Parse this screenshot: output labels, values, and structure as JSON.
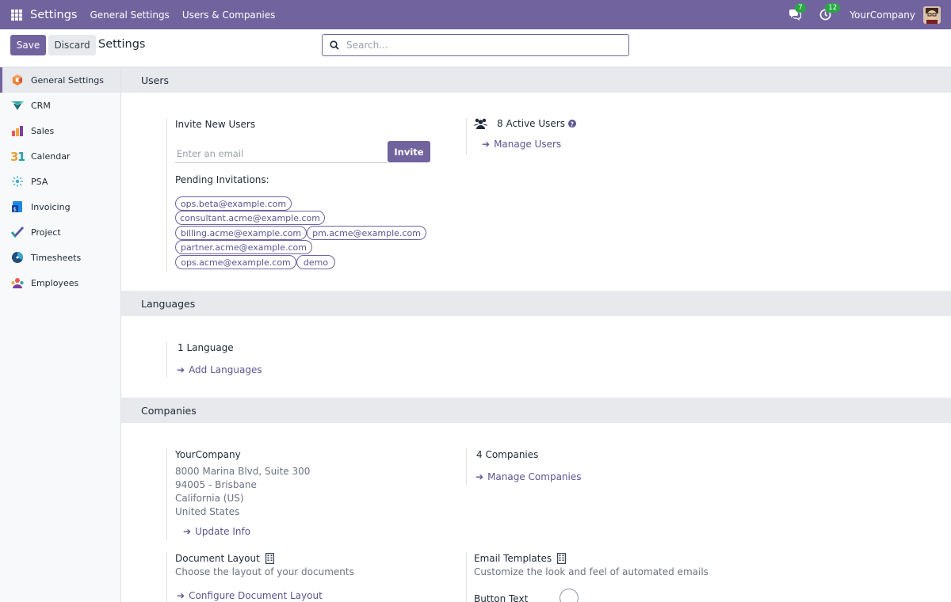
{
  "navbar": {
    "app_title": "Settings",
    "menu": [
      "General Settings",
      "Users & Companies"
    ],
    "messages_count": "7",
    "activities_count": "12",
    "company": "YourCompany"
  },
  "control": {
    "save_label": "Save",
    "discard_label": "Discard",
    "title": "Settings",
    "search_placeholder": "Search..."
  },
  "sidebar": {
    "items": [
      {
        "label": "General Settings",
        "icon": "settings-icon"
      },
      {
        "label": "CRM",
        "icon": "crm-icon"
      },
      {
        "label": "Sales",
        "icon": "sales-icon"
      },
      {
        "label": "Calendar",
        "icon": "calendar-icon"
      },
      {
        "label": "PSA",
        "icon": "psa-icon"
      },
      {
        "label": "Invoicing",
        "icon": "invoicing-icon"
      },
      {
        "label": "Project",
        "icon": "project-icon"
      },
      {
        "label": "Timesheets",
        "icon": "timesheets-icon"
      },
      {
        "label": "Employees",
        "icon": "employees-icon"
      }
    ]
  },
  "users": {
    "section_title": "Users",
    "invite_label": "Invite New Users",
    "email_placeholder": "Enter an email",
    "invite_button": "Invite",
    "pending_label": "Pending Invitations:",
    "pending": [
      "ops.beta@example.com",
      "consultant.acme@example.com",
      "billing.acme@example.com",
      "pm.acme@example.com",
      "partner.acme@example.com",
      "ops.acme@example.com",
      "demo"
    ],
    "active_users": "8 Active Users",
    "manage_users": "Manage Users"
  },
  "languages": {
    "section_title": "Languages",
    "count": "1 Language",
    "add_link": "Add Languages"
  },
  "companies": {
    "section_title": "Companies",
    "company_name": "YourCompany",
    "address": [
      "8000 Marina Blvd, Suite 300",
      "94005 - Brisbane",
      "California (US)",
      "United States"
    ],
    "update_info": "Update Info",
    "count": "4 Companies",
    "manage_link": "Manage Companies",
    "doc_layout_title": "Document Layout",
    "doc_layout_desc": "Choose the layout of your documents",
    "doc_layout_link": "Configure Document Layout",
    "email_templates_title": "Email Templates",
    "email_templates_desc": "Customize the look and feel of automated emails",
    "button_text_label": "Button Text"
  },
  "colors": {
    "brand": "#71639e",
    "badge": "#28a745",
    "section_bg": "#e7e9ed"
  }
}
